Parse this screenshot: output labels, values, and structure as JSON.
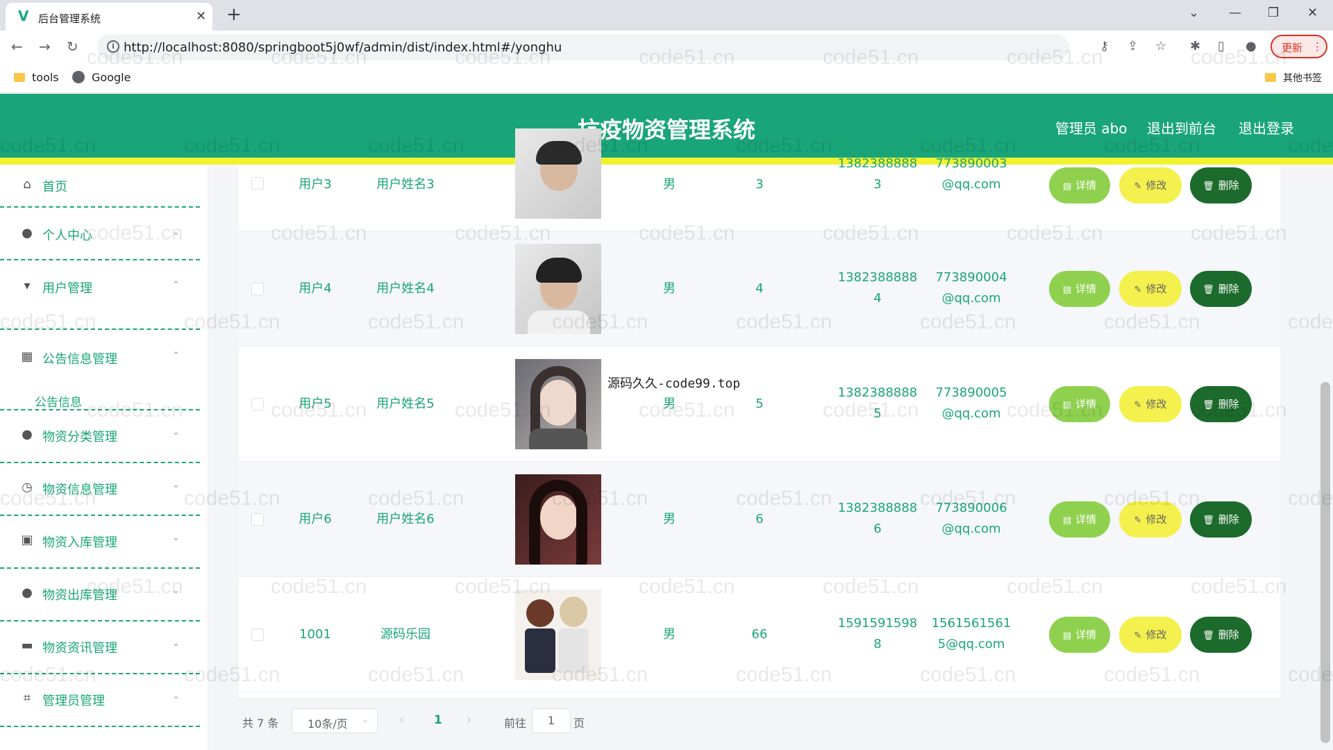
{
  "browser": {
    "tab_title": "后台管理系统",
    "url": "http://localhost:8080/springboot5j0wf/admin/dist/index.html#/yonghu",
    "update_label": "更新",
    "bookmarks": [
      "tools",
      "Google"
    ],
    "other_bookmarks": "其他书签"
  },
  "header": {
    "title": "抗疫物资管理系统",
    "admin_label": "管理员 abo",
    "front_link": "退出到前台",
    "logout_link": "退出登录"
  },
  "sidebar": {
    "items": [
      {
        "label": "首页",
        "icon": "home-icon"
      },
      {
        "label": "个人中心",
        "icon": "user-icon"
      },
      {
        "label": "用户管理",
        "icon": "users-icon"
      },
      {
        "label": "公告信息管理",
        "icon": "chart-icon"
      },
      {
        "label": "物资分类管理",
        "icon": "user-icon"
      },
      {
        "label": "物资信息管理",
        "icon": "clock-icon"
      },
      {
        "label": "物资入库管理",
        "icon": "clipboard-icon"
      },
      {
        "label": "物资出库管理",
        "icon": "location-icon"
      },
      {
        "label": "物资资讯管理",
        "icon": "briefcase-icon"
      },
      {
        "label": "管理员管理",
        "icon": "crop-icon"
      }
    ],
    "submenu_label": "公告信息"
  },
  "table": {
    "rows": [
      {
        "account": "用户3",
        "name": "用户姓名3",
        "gender": "男",
        "age": "3",
        "phone_a": "1382388888",
        "phone_b": "3",
        "email_a": "773890003",
        "email_b": "@qq.com"
      },
      {
        "account": "用户4",
        "name": "用户姓名4",
        "gender": "男",
        "age": "4",
        "phone_a": "1382388888",
        "phone_b": "4",
        "email_a": "773890004",
        "email_b": "@qq.com"
      },
      {
        "account": "用户5",
        "name": "用户姓名5",
        "gender": "男",
        "age": "5",
        "phone_a": "1382388888",
        "phone_b": "5",
        "email_a": "773890005",
        "email_b": "@qq.com"
      },
      {
        "account": "用户6",
        "name": "用户姓名6",
        "gender": "男",
        "age": "6",
        "phone_a": "1382388888",
        "phone_b": "6",
        "email_a": "773890006",
        "email_b": "@qq.com"
      },
      {
        "account": "1001",
        "name": "源码乐园",
        "gender": "男",
        "age": "66",
        "phone_a": "1591591598",
        "phone_b": "8",
        "email_a": "1561561561",
        "email_b": "5@qq.com"
      }
    ],
    "btn_detail": "详情",
    "btn_edit": "修改",
    "btn_delete": "删除",
    "tooltip": "源码久久-code99.top"
  },
  "pagination": {
    "total": "共 7 条",
    "page_size": "10条/页",
    "current_page": "1",
    "goto_label": "前往",
    "goto_value": "1",
    "unit": "页"
  },
  "watermark": "code51.cn",
  "colors": {
    "header_green": "#1aa579",
    "accent_yellow": "#f1f32f",
    "detail_button": "#8fd14f",
    "edit_button": "#f4f04d",
    "delete_button": "#1c6b2c"
  }
}
